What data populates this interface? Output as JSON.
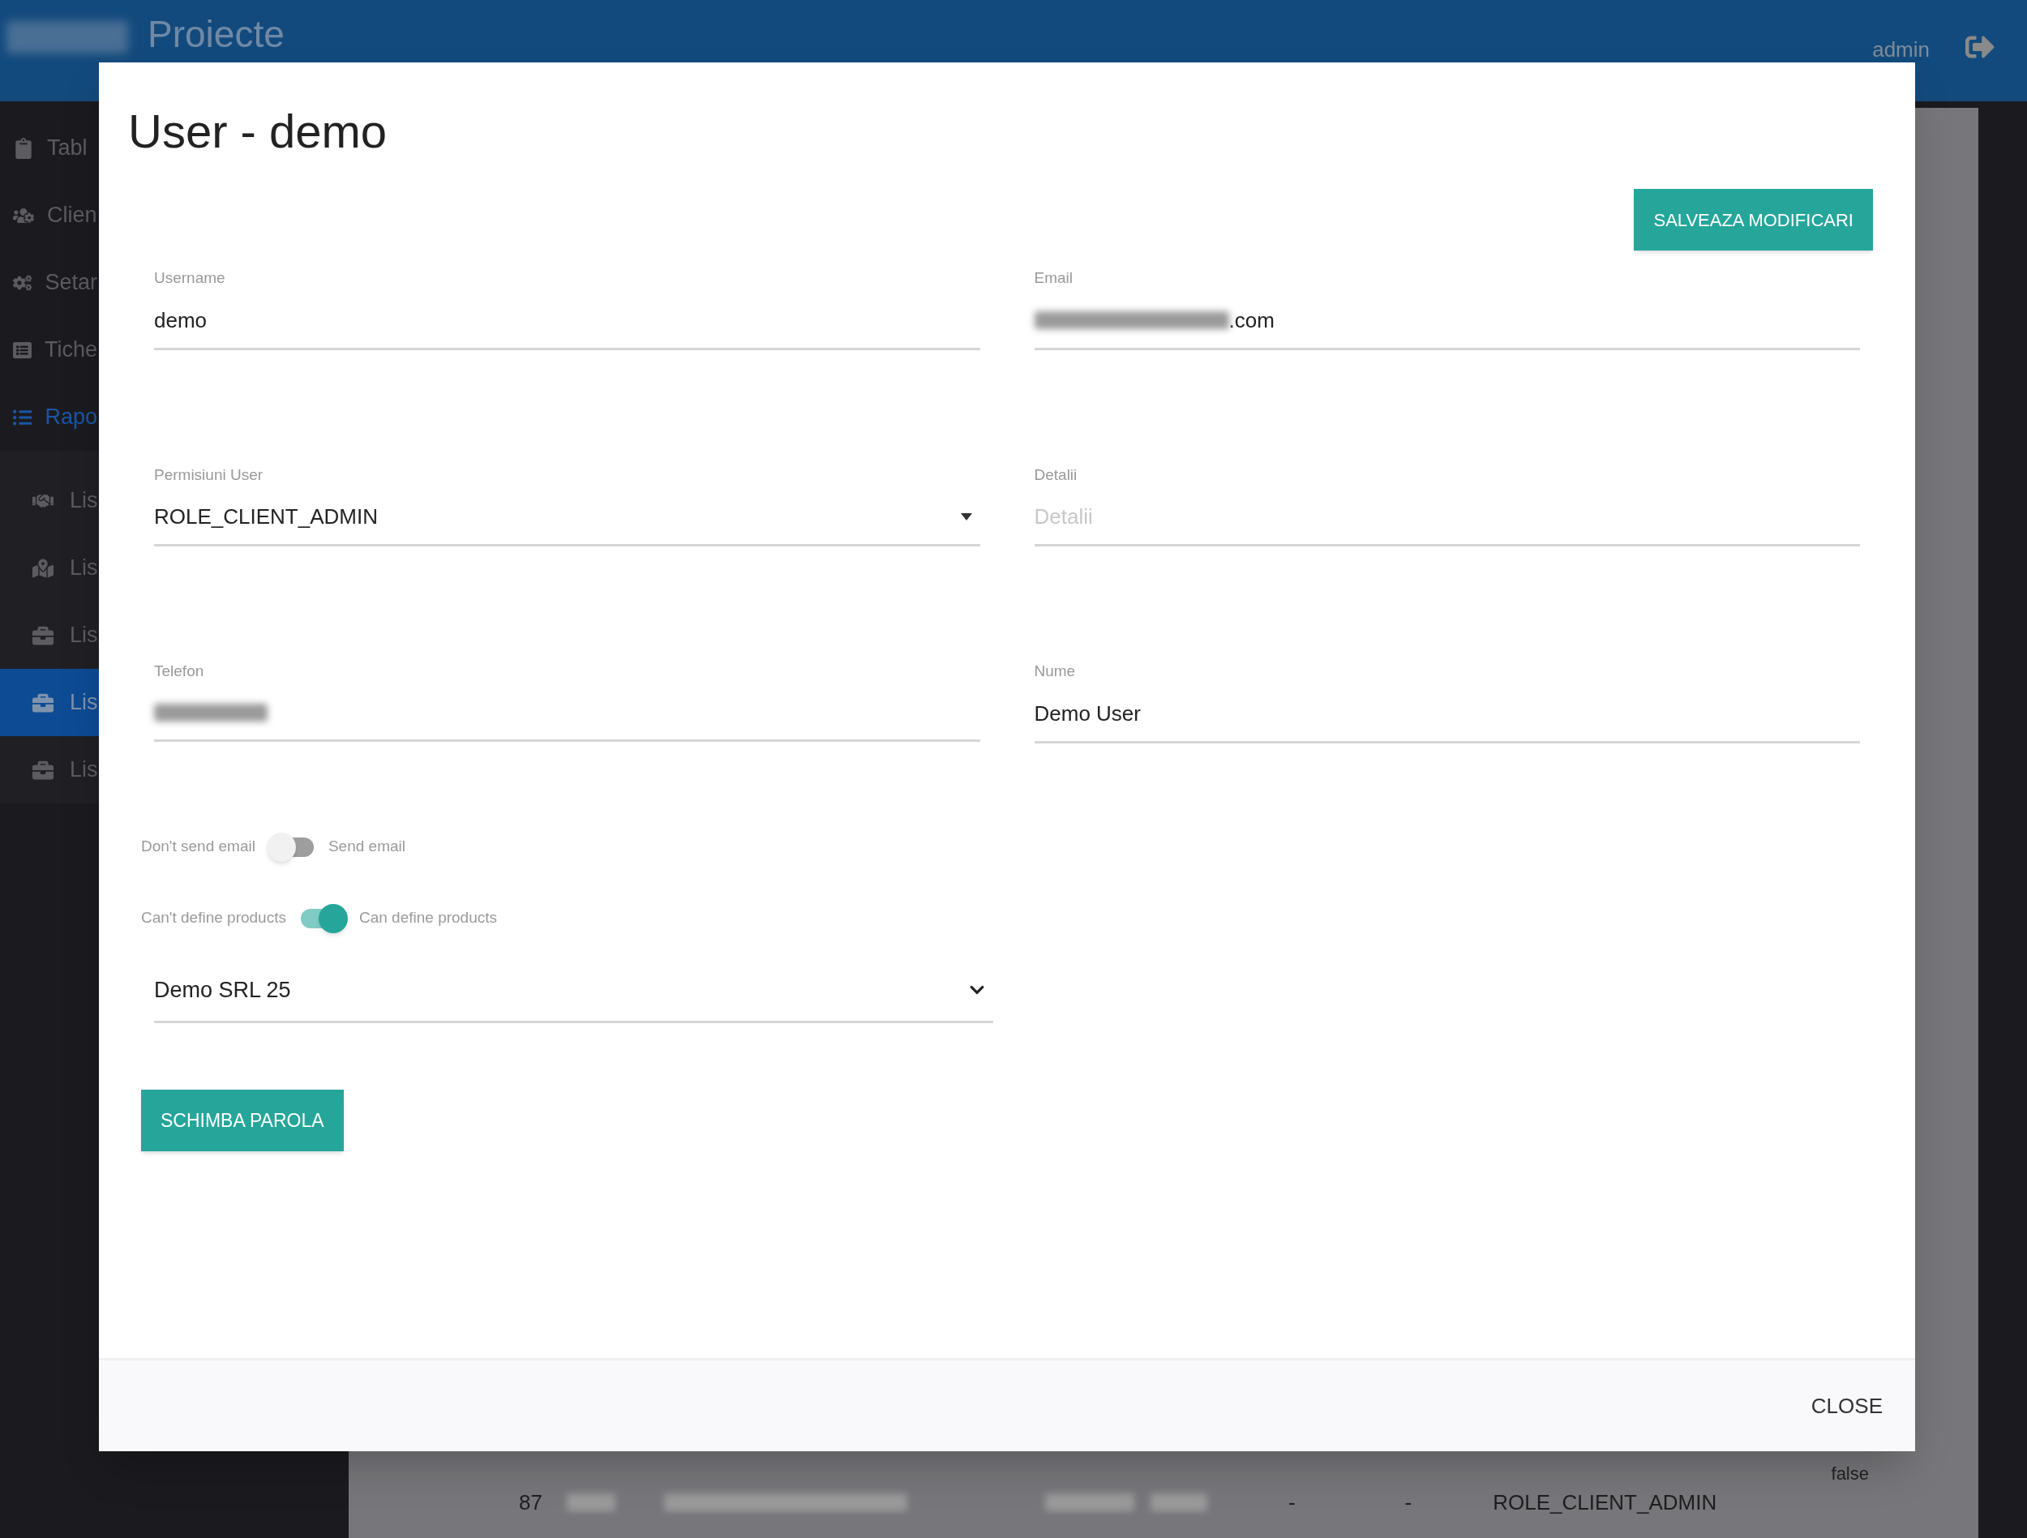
{
  "app_header": {
    "title": "Proiecte",
    "user": "admin"
  },
  "sidebar": {
    "items": [
      {
        "label": "Tabl",
        "selected": false
      },
      {
        "label": "Clien",
        "selected": false
      },
      {
        "label": "Setar",
        "selected": false
      },
      {
        "label": "Tiche",
        "selected": false
      },
      {
        "label": "Rapo",
        "selected": true,
        "children": [
          {
            "label": "Lis",
            "selected": false
          },
          {
            "label": "Lis",
            "selected": false
          },
          {
            "label": "Lis",
            "selected": false
          },
          {
            "label": "Lis",
            "selected": true
          },
          {
            "label": "Lis",
            "selected": false
          }
        ]
      }
    ]
  },
  "background_table": {
    "cut_cell": "false",
    "row": {
      "number": "87",
      "column_5": "-",
      "column_6": "-",
      "role": "ROLE_CLIENT_ADMIN"
    }
  },
  "modal": {
    "title": "User - demo",
    "save_button": "SALVEAZA MODIFICARI",
    "fields": [
      {
        "kind": "text",
        "label": "Username",
        "value": "demo"
      },
      {
        "kind": "partly_redacted",
        "label": "Email",
        "value": ".com"
      },
      {
        "kind": "select",
        "label": "Permisiuni User",
        "value": "ROLE_CLIENT_ADMIN"
      },
      {
        "kind": "text",
        "label": "Detalii",
        "placeholder": "Detalii"
      },
      {
        "kind": "redacted",
        "label": "Telefon"
      },
      {
        "kind": "text",
        "label": "Nume",
        "value": "Demo User"
      }
    ],
    "toggles": [
      {
        "off_label": "Don't send email",
        "on_label": "Send email",
        "on": false
      },
      {
        "off_label": "Can't define products",
        "on_label": "Can define products",
        "on": true
      }
    ],
    "company_select": {
      "value": "Demo SRL 25"
    },
    "change_password_button": "SCHIMBA PAROLA",
    "close_button": "CLOSE"
  }
}
